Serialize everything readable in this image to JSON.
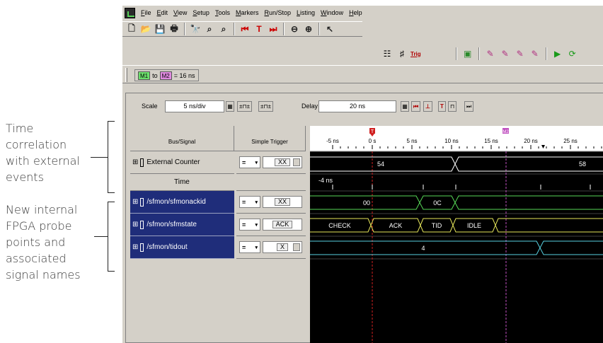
{
  "annotations": {
    "time_correlation": [
      "Time",
      "correlation",
      "with external",
      "events"
    ],
    "new_probe_points": [
      "New internal",
      "FPGA probe",
      "points and",
      "associated",
      "signal names"
    ]
  },
  "menu": [
    "File",
    "Edit",
    "View",
    "Setup",
    "Tools",
    "Markers",
    "Run/Stop",
    "Listing",
    "Window",
    "Help"
  ],
  "toolbar2": {
    "trig_label": "Trig"
  },
  "markers": {
    "m1": "M1",
    "to": "to",
    "m2": "M2",
    "interval": "= 16 ns"
  },
  "scale": {
    "label": "Scale",
    "value": "5 ns/div"
  },
  "delay": {
    "label": "Delay",
    "value": "20 ns"
  },
  "columns": {
    "bus_signal": "Bus/Signal",
    "simple_trigger": "Simple Trigger"
  },
  "signals": [
    {
      "name": "External Counter",
      "op": "=",
      "trigger": "XX"
    },
    {
      "name": "Time"
    },
    {
      "name": "/sfmon/sfmonackid",
      "op": "=",
      "trigger": "XX"
    },
    {
      "name": "/sfmon/sfmstate",
      "op": "=",
      "trigger": "ACK"
    },
    {
      "name": "/sfmon/tidout",
      "op": "=",
      "trigger": "X"
    }
  ],
  "timeline": {
    "ticks": [
      "-5 ns",
      "0 s",
      "5 ns",
      "10 ns",
      "15 ns",
      "20 ns",
      "25 ns"
    ],
    "marker_t": "T",
    "marker_m2": "M2",
    "time_row_label": "-4 ns"
  },
  "waveform_values": {
    "counter": [
      "54",
      "58"
    ],
    "ackid": [
      "00",
      "0C"
    ],
    "state": [
      "CHECK",
      "ACK",
      "TID",
      "IDLE"
    ],
    "tidout": [
      "4"
    ]
  },
  "colors": {
    "counter": "#ffffff",
    "ackid": "#57d957",
    "state": "#e6e65a",
    "tidout": "#57d0e0",
    "trigger_marker": "#d02020",
    "m2_marker": "#c050c0",
    "selected_row": "#1f2d7a"
  }
}
